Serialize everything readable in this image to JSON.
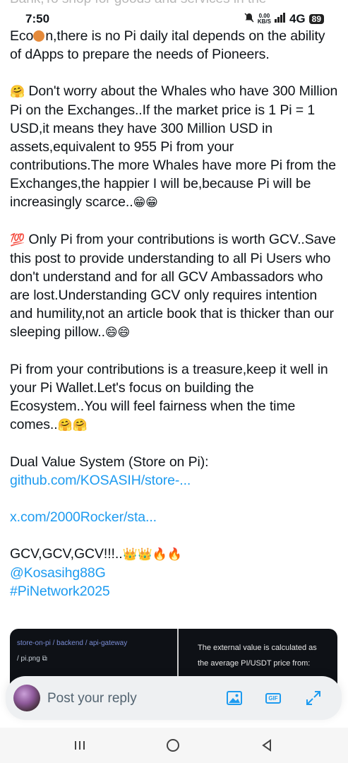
{
  "status_bar": {
    "time": "7:50",
    "net_speed_value": "0.00",
    "net_speed_unit": "KB/S",
    "network": "4G",
    "battery": "89"
  },
  "faded_top_text": "Bank,To shop for goods and services in the",
  "post": {
    "p1_line1_prefix": "Eco",
    "p1_line1_suffix": "n,there is no Pi daily i",
    "p1_line1_end": "tal",
    "p1_rest": "depends on the ability of dApps to prepare the needs of Pioneers.",
    "p2_emoji": "🤗",
    "p2_text": " Don't worry about the Whales who have 300 Million Pi on the Exchanges..If the market price is 1 Pi = 1 USD,it means they have 300 Million USD in assets,equivalent to 955 Pi from your contributions.The more Whales have more Pi from the Exchanges,the happier I will be,because Pi will be increasingly scarce..",
    "p2_end_emoji": "😁😁",
    "p3_emoji": "💯",
    "p3_text": " Only Pi from your contributions is worth GCV..Save this post to provide understanding to all Pi Users who don't understand and for all GCV Ambassadors who are lost.Understanding GCV only requires intention and humility,not an article book that is thicker than our sleeping pillow..",
    "p3_end_emoji": "😄😄",
    "p4_text": "Pi from your contributions is a treasure,keep it well in your Pi Wallet.Let's focus on building the Ecosystem..You will feel fairness when the time comes..",
    "p4_end_emoji": "🤗🤗",
    "p5_label": "Dual Value System (Store on Pi):",
    "p5_link": "github.com/KOSASIH/store-...",
    "p6_link": "x.com/2000Rocker/sta...",
    "p7_text": "GCV,GCV,GCV!!!..",
    "p7_emoji": "👑👑🔥🔥",
    "mention": "@Kosasihg88G",
    "hashtag": "#PiNetwork2025"
  },
  "card": {
    "breadcrumb": "store-on-pi / backend / api-gateway",
    "file": "/ pi.png",
    "right_text": "The external value is calculated as the average PI/USDT price from:"
  },
  "reply": {
    "placeholder": "Post your reply",
    "gif_label": "GIF"
  },
  "colors": {
    "link": "#1d9bf0",
    "text": "#0f1419",
    "reply_bg": "#eef0f2"
  },
  "icons": [
    "wifi-icon",
    "signal-icon",
    "battery-icon",
    "image-icon",
    "gif-icon",
    "expand-icon",
    "menu-icon",
    "home-icon",
    "back-icon",
    "coin-icon"
  ]
}
